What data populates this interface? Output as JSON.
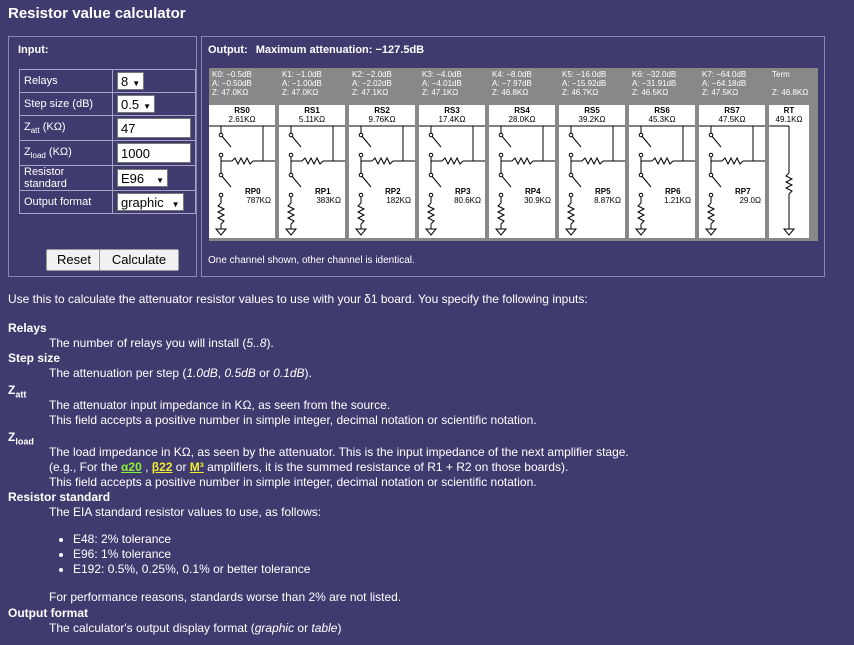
{
  "title": "Resistor value calculator",
  "input": {
    "heading": "Input:",
    "relays": {
      "label": "Relays",
      "value": "8"
    },
    "step": {
      "label": "Step size (dB)",
      "value": "0.5"
    },
    "zatt": {
      "label_main": "Z",
      "label_sub": "att",
      "label_rest": " (KΩ)",
      "value": "47"
    },
    "zload": {
      "label_main": "Z",
      "label_sub": "load",
      "label_rest": " (KΩ)",
      "value": "1000"
    },
    "standard": {
      "label": "Resistor standard",
      "value": "E96"
    },
    "format": {
      "label": "Output format",
      "value": "graphic"
    },
    "reset_label": "Reset",
    "calculate_label": "Calculate"
  },
  "output": {
    "heading": "Output:",
    "max_atten": "Maximum attenuation: −127.5dB",
    "note": "One channel shown, other channel is identical.",
    "channels": [
      {
        "k": "K0: −0.5dB",
        "a": "A: −0.50dB",
        "z": "Z: 47.0KΩ",
        "rs": "RS0",
        "rsv": "2.61KΩ",
        "rp": "RP0",
        "rpv": "787KΩ"
      },
      {
        "k": "K1: −1.0dB",
        "a": "A: −1.00dB",
        "z": "Z: 47.0KΩ",
        "rs": "RS1",
        "rsv": "5.11KΩ",
        "rp": "RP1",
        "rpv": "383KΩ"
      },
      {
        "k": "K2: −2.0dB",
        "a": "A: −2.02dB",
        "z": "Z: 47.1KΩ",
        "rs": "RS2",
        "rsv": "9.76KΩ",
        "rp": "RP2",
        "rpv": "182KΩ"
      },
      {
        "k": "K3: −4.0dB",
        "a": "A: −4.01dB",
        "z": "Z: 47.1KΩ",
        "rs": "RS3",
        "rsv": "17.4KΩ",
        "rp": "RP3",
        "rpv": "80.6KΩ"
      },
      {
        "k": "K4: −8.0dB",
        "a": "A: −7.97dB",
        "z": "Z: 46.8KΩ",
        "rs": "RS4",
        "rsv": "28.0KΩ",
        "rp": "RP4",
        "rpv": "30.9KΩ"
      },
      {
        "k": "K5: −16.0dB",
        "a": "A: −15.92dB",
        "z": "Z: 46.7KΩ",
        "rs": "RS5",
        "rsv": "39.2KΩ",
        "rp": "RP5",
        "rpv": "8.87KΩ"
      },
      {
        "k": "K6: −32.0dB",
        "a": "A: −31.91dB",
        "z": "Z: 46.5KΩ",
        "rs": "RS6",
        "rsv": "45.3KΩ",
        "rp": "RP6",
        "rpv": "1.21KΩ"
      },
      {
        "k": "K7: −64.0dB",
        "a": "A: −64.18dB",
        "z": "Z: 47.5KΩ",
        "rs": "RS7",
        "rsv": "47.5KΩ",
        "rp": "RP7",
        "rpv": "29.0Ω"
      }
    ],
    "term": {
      "label": "Term",
      "z": "Z: 46.8KΩ",
      "rt": "RT",
      "rtv": "49.1KΩ"
    }
  },
  "help": {
    "intro": "Use this to calculate the attenuator resistor values to use with your δ1 board. You specify the following inputs:",
    "relays_t": "Relays",
    "relays_d1": "The number of relays you will install (",
    "relays_range": "5..8",
    "relays_d2": ").",
    "step_t": "Step size",
    "step_d1": "The attenuation per step (",
    "step_o1": "1.0dB",
    "step_sep1": ", ",
    "step_o2": "0.5dB",
    "step_sep2": " or ",
    "step_o3": "0.1dB",
    "step_d2": ").",
    "zatt_t": "Z",
    "zatt_sub": "att",
    "zatt_d1": "The attenuator input impedance in KΩ, as seen from the source.",
    "zatt_d2": "This field accepts a positive number in simple integer, decimal notation or scientific notation.",
    "zload_t": "Z",
    "zload_sub": "load",
    "zload_d1": "The load impedance in KΩ, as seen by the attenuator. This is the input impedance of the next amplifier stage.",
    "zload_d2a": "(e.g., For the ",
    "link_a20": "α20",
    "zload_sep1": " , ",
    "link_b22": "β22",
    "zload_sep2": " or ",
    "link_m3": "M³",
    "zload_d2b": " amplifiers, it is the summed resistance of R1 + R2 on those boards).",
    "zload_d3": "This field accepts a positive number in simple integer, decimal notation or scientific notation.",
    "std_t": "Resistor standard",
    "std_d": "The EIA standard resistor values to use, as follows:",
    "std_items": [
      "E48: 2% tolerance",
      "E96: 1% tolerance",
      "E192: 0.5%, 0.25%, 0.1% or better tolerance"
    ],
    "std_note": "For performance reasons, standards worse than 2% are not listed.",
    "fmt_t": "Output format",
    "fmt_d1": "The calculator's output display format (",
    "fmt_o1": "graphic",
    "fmt_or": " or ",
    "fmt_o2": "table",
    "fmt_d2": ")"
  }
}
